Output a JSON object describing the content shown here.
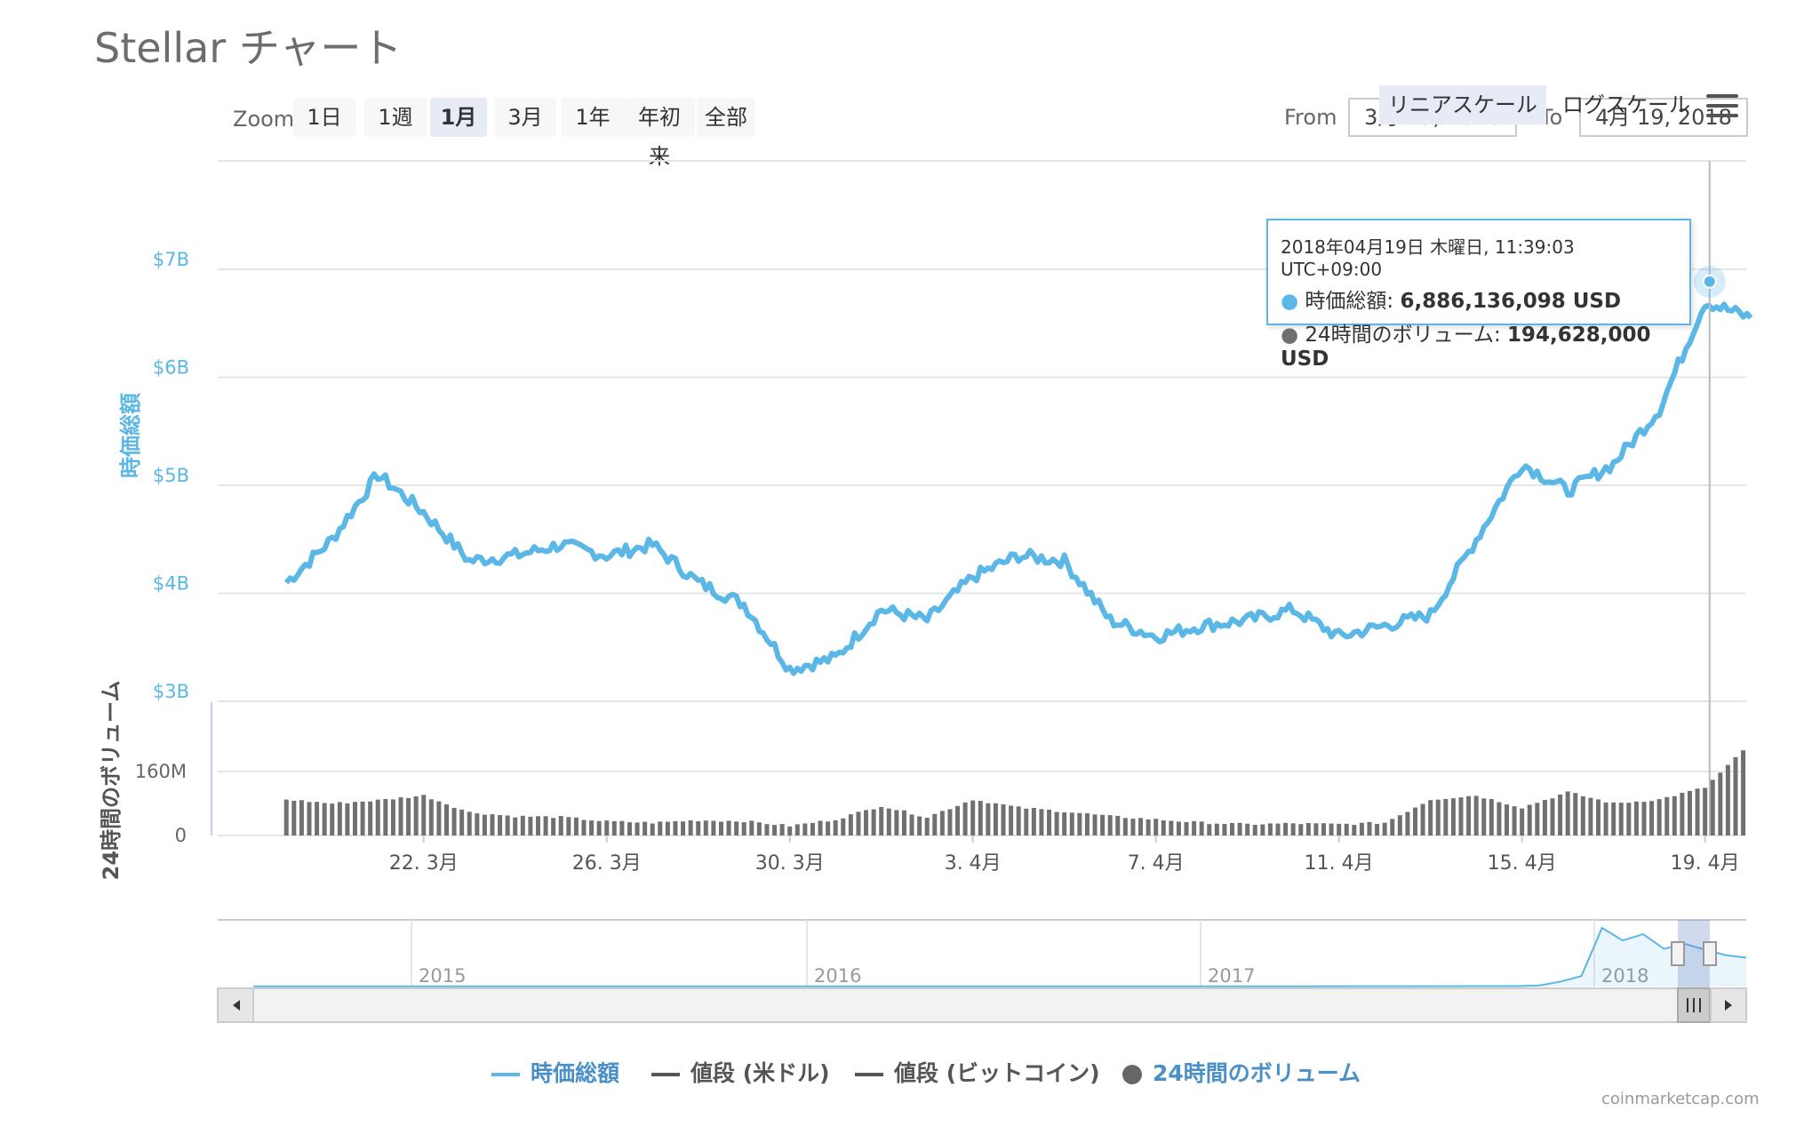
{
  "title": "Stellar チャート",
  "toolbar": {
    "zoom_label": "Zoom",
    "zoom_buttons": [
      "1日",
      "1週",
      "1月",
      "3月",
      "1年",
      "年初来",
      "全部"
    ],
    "zoom_active": "1月",
    "from_label": "From",
    "to_label": "To",
    "from_value": "3月 19, 2018",
    "to_value": "4月 19, 2018",
    "linear_label": "リニアスケール",
    "log_label": "ログスケール"
  },
  "tooltip": {
    "date": "2018年04月19日 木曜日, 11:39:03 UTC+09:00",
    "mcap_label": "時価総額:",
    "mcap_value": "6,886,136,098 USD",
    "vol_label": "24時間のボリューム:",
    "vol_value": "194,628,000 USD"
  },
  "legend": [
    {
      "label": "時価総額",
      "color": "#5bb7e6",
      "kind": "line",
      "active": true
    },
    {
      "label": "値段 (米ドル)",
      "color": "#555555",
      "kind": "line",
      "active": false
    },
    {
      "label": "値段 (ビットコイン)",
      "color": "#555555",
      "kind": "line",
      "active": false
    },
    {
      "label": "24時間のボリューム",
      "color": "#666666",
      "kind": "dot",
      "active": true
    }
  ],
  "credit": "coinmarketcap.com",
  "colors": {
    "mcap": "#5bb7e6",
    "volume": "#707070",
    "grid": "#e6e6e6",
    "accent_blue": "#4a90c6"
  },
  "chart_data": {
    "type": "line",
    "title": "Stellar チャート",
    "x_range": [
      "2018-03-19",
      "2018-04-19"
    ],
    "x_ticks": [
      "22. 3月",
      "26. 3月",
      "30. 3月",
      "3. 4月",
      "7. 4月",
      "11. 4月",
      "15. 4月",
      "19. 4月"
    ],
    "mcap_axis": {
      "label": "時価総額",
      "ticks": [
        "$3B",
        "$4B",
        "$5B",
        "$6B",
        "$7B"
      ],
      "range_billion_usd": [
        3,
        7
      ]
    },
    "volume_axis": {
      "label": "24時間のボリューム",
      "ticks": [
        "0",
        "160M"
      ],
      "range_million_usd": [
        0,
        160
      ]
    },
    "series": [
      {
        "name": "時価総額",
        "unit": "billion USD",
        "x": [
          "2018-03-19",
          "2018-03-20",
          "2018-03-21",
          "2018-03-22",
          "2018-03-23",
          "2018-03-24",
          "2018-03-25",
          "2018-03-26",
          "2018-03-27",
          "2018-03-28",
          "2018-03-29",
          "2018-03-30",
          "2018-03-31",
          "2018-04-01",
          "2018-04-02",
          "2018-04-03",
          "2018-04-04",
          "2018-04-05",
          "2018-04-06",
          "2018-04-07",
          "2018-04-08",
          "2018-04-09",
          "2018-04-10",
          "2018-04-11",
          "2018-04-12",
          "2018-04-13",
          "2018-04-14",
          "2018-04-15",
          "2018-04-16",
          "2018-04-17",
          "2018-04-18",
          "2018-04-19",
          "2018-04-20"
        ],
        "values": [
          4.1,
          4.5,
          5.1,
          4.75,
          4.3,
          4.35,
          4.45,
          4.35,
          4.45,
          4.1,
          3.9,
          3.3,
          3.4,
          3.85,
          3.75,
          4.15,
          4.35,
          4.3,
          3.75,
          3.6,
          3.7,
          3.75,
          3.85,
          3.6,
          3.7,
          3.8,
          4.5,
          5.2,
          4.95,
          5.2,
          5.7,
          6.7,
          6.55
        ]
      },
      {
        "name": "24時間のボリューム",
        "unit": "million USD",
        "x": [
          "2018-03-19",
          "2018-03-20",
          "2018-03-21",
          "2018-03-22",
          "2018-03-23",
          "2018-03-24",
          "2018-03-25",
          "2018-03-26",
          "2018-03-27",
          "2018-03-28",
          "2018-03-29",
          "2018-03-30",
          "2018-03-31",
          "2018-04-01",
          "2018-04-02",
          "2018-04-03",
          "2018-04-04",
          "2018-04-05",
          "2018-04-06",
          "2018-04-07",
          "2018-04-08",
          "2018-04-09",
          "2018-04-10",
          "2018-04-11",
          "2018-04-12",
          "2018-04-13",
          "2018-04-14",
          "2018-04-15",
          "2018-04-16",
          "2018-04-17",
          "2018-04-18",
          "2018-04-19",
          "2018-04-20"
        ],
        "values": [
          90,
          80,
          88,
          100,
          58,
          48,
          46,
          35,
          32,
          38,
          36,
          24,
          40,
          74,
          46,
          90,
          70,
          60,
          48,
          40,
          32,
          28,
          30,
          28,
          32,
          90,
          100,
          70,
          108,
          80,
          90,
          120,
          230
        ]
      }
    ],
    "navigator": {
      "year_labels": [
        "2015",
        "2016",
        "2017",
        "2018"
      ],
      "series_name": "時価総額",
      "values": [
        0.05,
        0.05,
        0.05,
        0.05,
        0.05,
        0.05,
        0.06,
        0.06,
        0.06,
        0.06,
        0.08,
        0.1,
        0.3,
        1.2,
        2.5,
        14,
        11,
        12.5,
        9,
        10.2,
        8.8,
        7.5,
        6.9
      ]
    }
  }
}
